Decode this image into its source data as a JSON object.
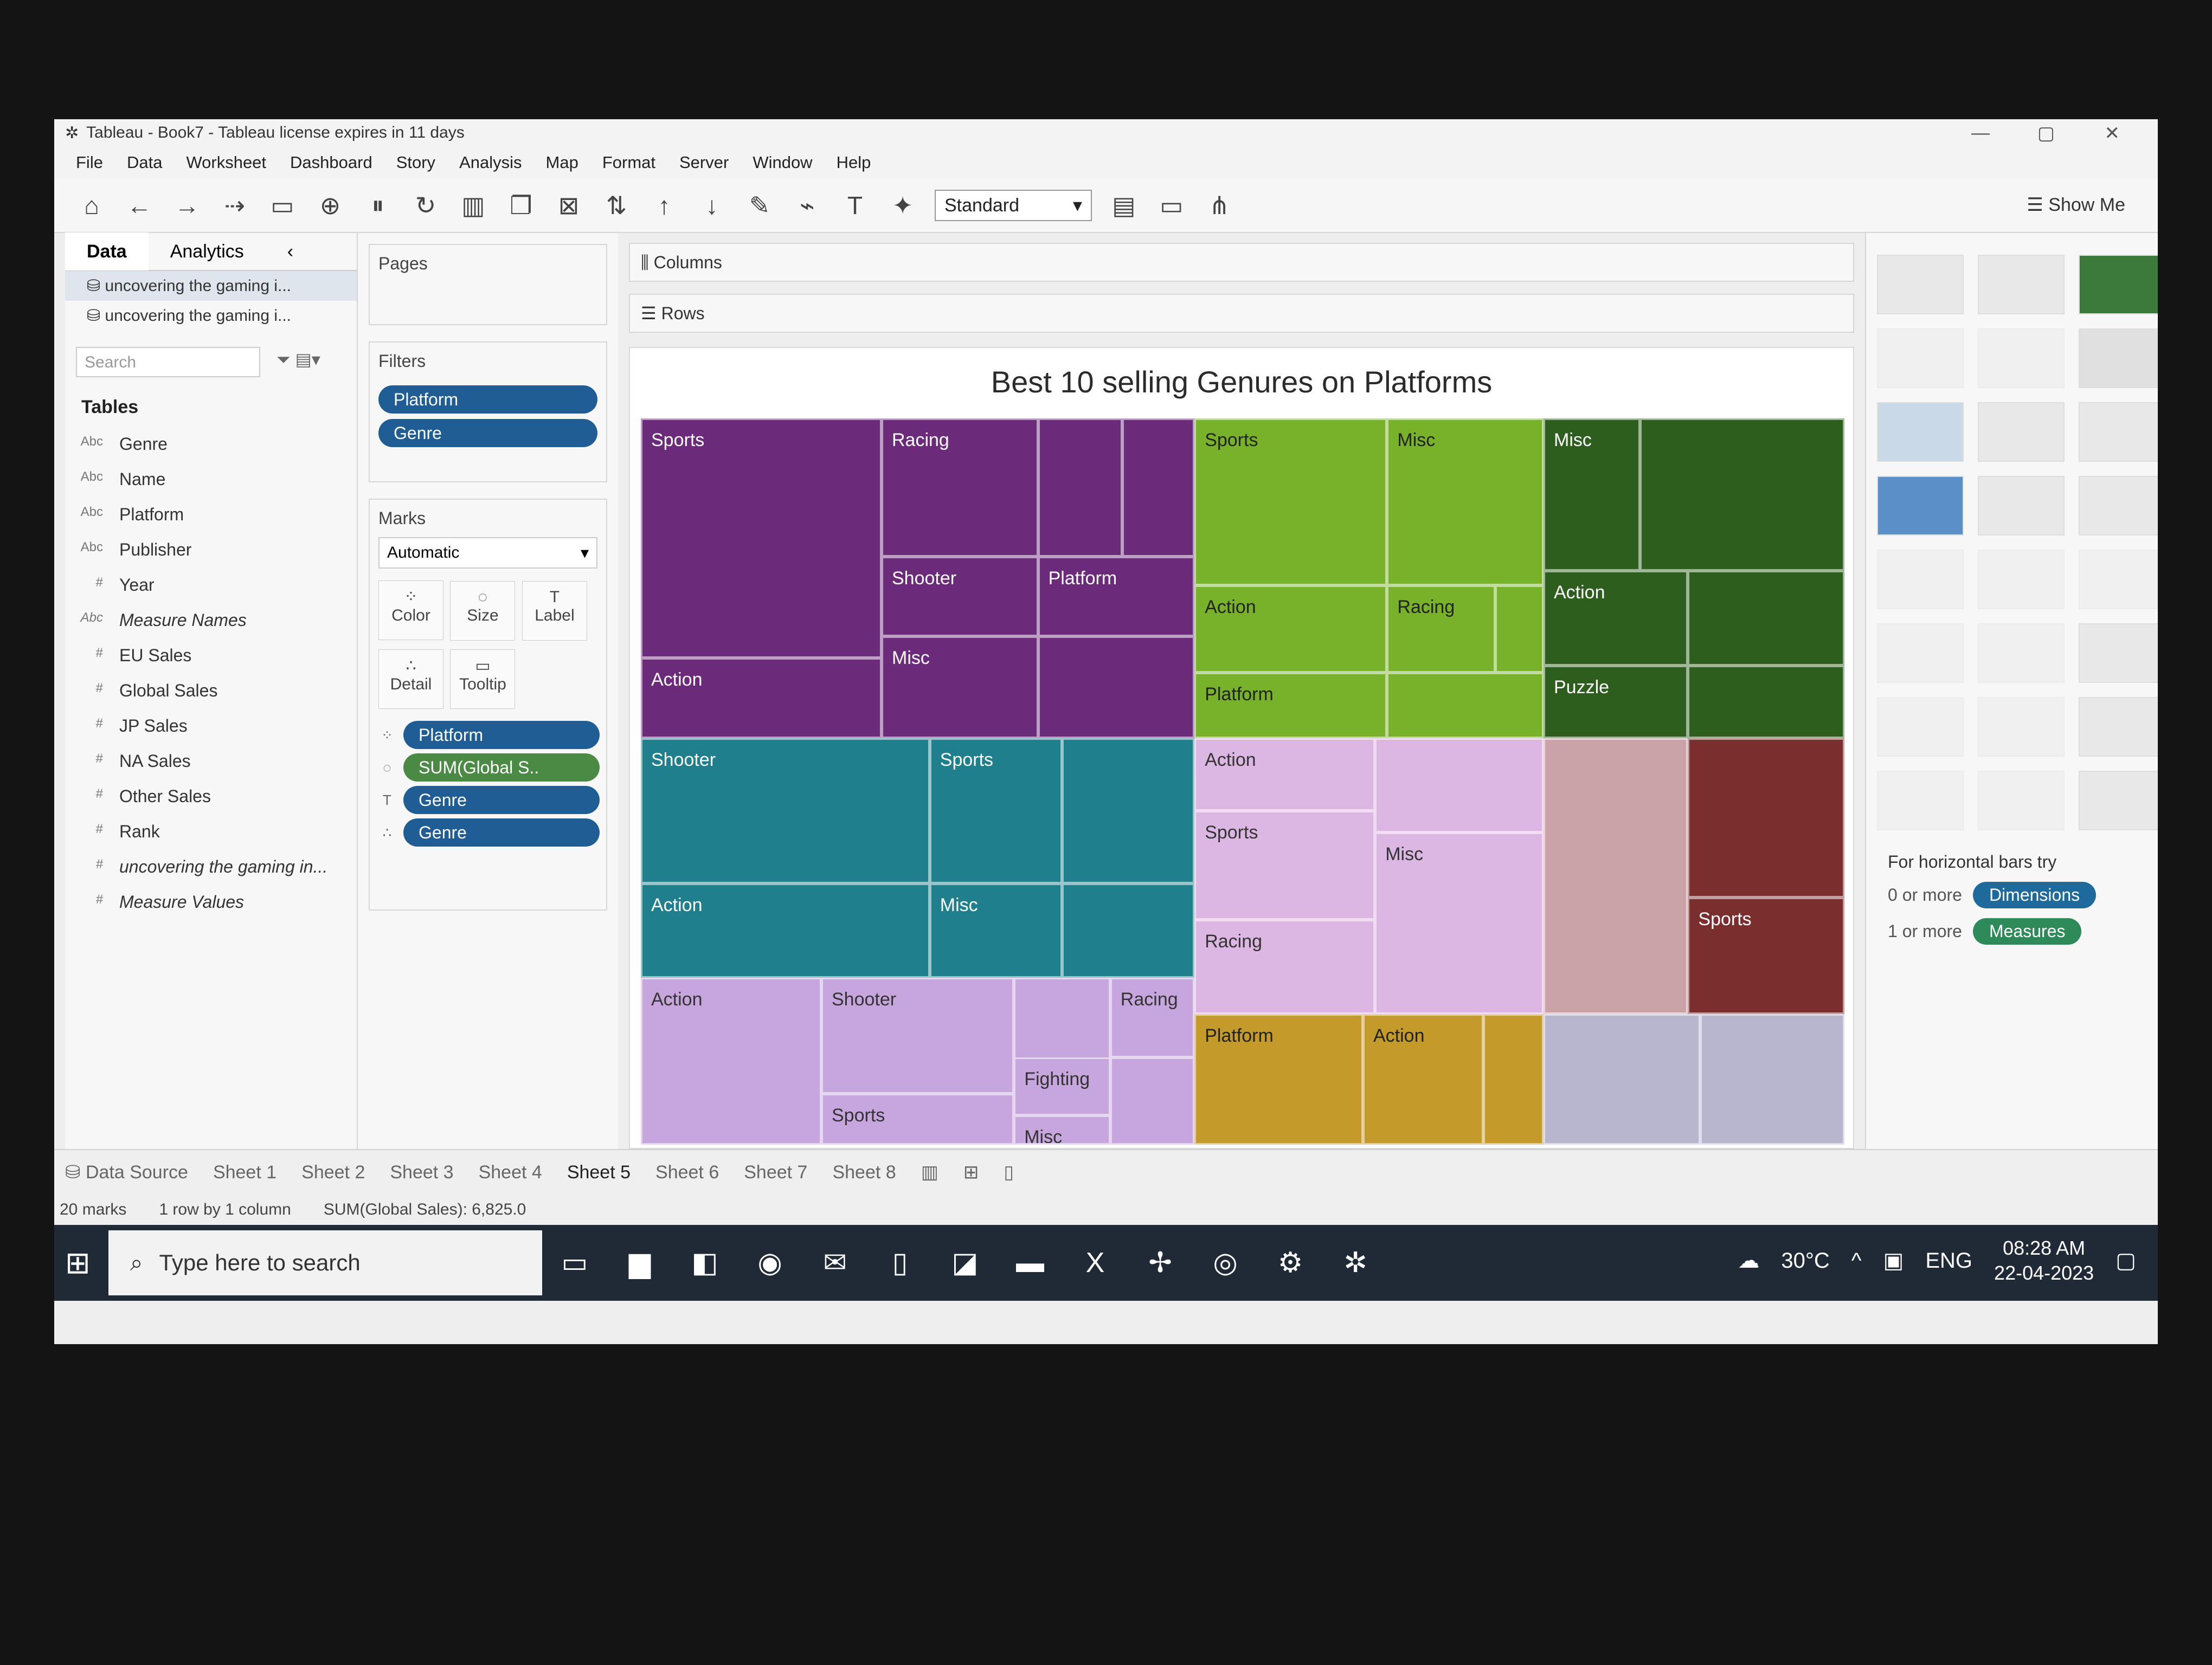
{
  "window": {
    "title": "Tableau - Book7 - Tableau license expires in 11 days",
    "icon": "tableau-icon"
  },
  "menu": [
    "File",
    "Data",
    "Worksheet",
    "Dashboard",
    "Story",
    "Analysis",
    "Map",
    "Format",
    "Server",
    "Window",
    "Help"
  ],
  "toolbar": {
    "fit_select": "Standard",
    "show_me": "Show Me"
  },
  "data_pane": {
    "tab_data": "Data",
    "tab_analytics": "Analytics",
    "sources": [
      "uncovering the gaming i...",
      "uncovering the gaming i..."
    ],
    "search_placeholder": "Search",
    "tables_heading": "Tables",
    "fields": [
      {
        "type": "Abc",
        "name": "Genre"
      },
      {
        "type": "Abc",
        "name": "Name"
      },
      {
        "type": "Abc",
        "name": "Platform"
      },
      {
        "type": "Abc",
        "name": "Publisher"
      },
      {
        "type": "#",
        "name": "Year"
      },
      {
        "type": "Abc",
        "name": "Measure Names"
      },
      {
        "type": "#",
        "name": "EU Sales"
      },
      {
        "type": "#",
        "name": "Global Sales"
      },
      {
        "type": "#",
        "name": "JP Sales"
      },
      {
        "type": "#",
        "name": "NA Sales"
      },
      {
        "type": "#",
        "name": "Other Sales"
      },
      {
        "type": "#",
        "name": "Rank"
      },
      {
        "type": "#",
        "name": "uncovering the gaming in..."
      },
      {
        "type": "#",
        "name": "Measure Values"
      }
    ]
  },
  "pages": {
    "title": "Pages"
  },
  "filters": {
    "title": "Filters",
    "pills": [
      "Platform",
      "Genre"
    ]
  },
  "marks": {
    "title": "Marks",
    "type": "Automatic",
    "buttons": [
      "Color",
      "Size",
      "Label",
      "Detail",
      "Tooltip"
    ],
    "pills": [
      "Platform",
      "SUM(Global S..",
      "Genre",
      "Genre"
    ]
  },
  "shelves": {
    "columns": "Columns",
    "rows": "Rows"
  },
  "chart_data": {
    "type": "treemap",
    "title": "Best 10 selling Genures on Platforms",
    "labels_visible": [
      "Sports",
      "Racing",
      "Action",
      "Shooter",
      "Platform",
      "Misc",
      "Sports",
      "Misc",
      "Action",
      "Racing",
      "Platform",
      "Misc",
      "Action",
      "Puzzle",
      "Shooter",
      "Sports",
      "Action",
      "Misc",
      "Action",
      "Shooter",
      "Racing",
      "Sports",
      "Fighting",
      "Misc",
      "Action",
      "Sports",
      "Racing",
      "Misc",
      "Sports",
      "Platform",
      "Action"
    ]
  },
  "show_me": {
    "hint": "For horizontal bars try",
    "req1_text": "0 or more",
    "req1_tag": "Dimensions",
    "req2_text": "1 or more",
    "req2_tag": "Measures"
  },
  "sheet_tabs": [
    "Data Source",
    "Sheet 1",
    "Sheet 2",
    "Sheet 3",
    "Sheet 4",
    "Sheet 5",
    "Sheet 6",
    "Sheet 7",
    "Sheet 8"
  ],
  "status": {
    "marks": "20 marks",
    "rows": "1 row by 1 column",
    "sum": "SUM(Global Sales): 6,825.0"
  },
  "taskbar": {
    "search": "Type here to search",
    "temp": "30°C",
    "lang": "ENG",
    "time": "08:28 AM",
    "date": "22-04-2023"
  }
}
